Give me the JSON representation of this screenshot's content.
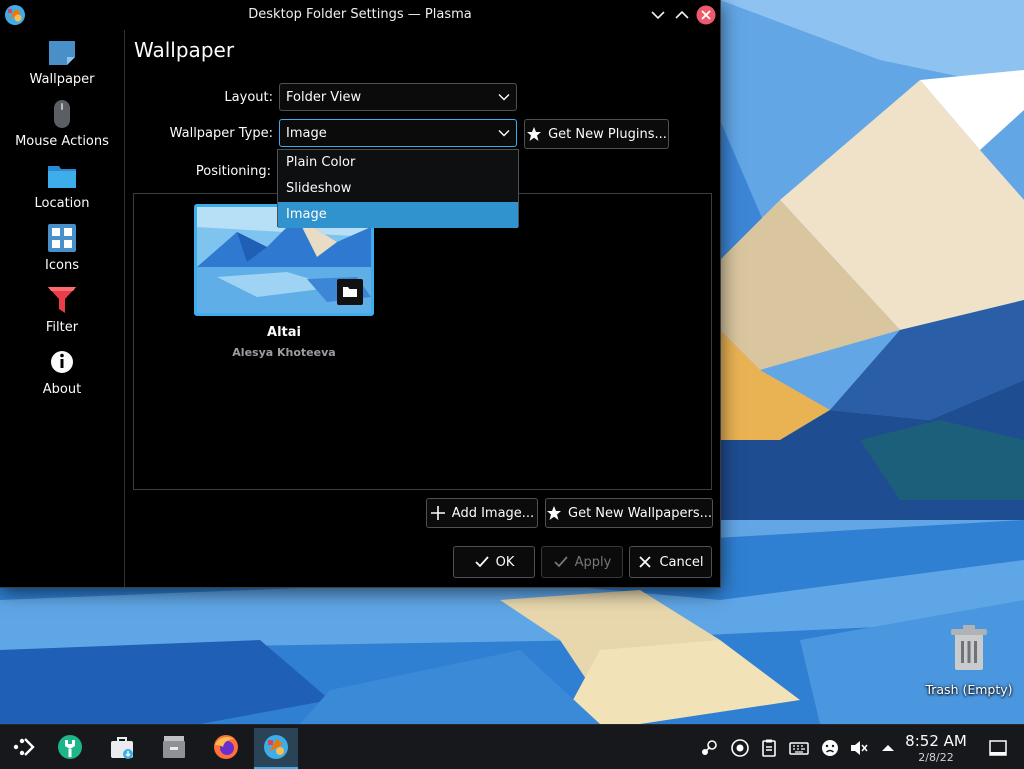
{
  "window": {
    "title": "Desktop Folder Settings — Plasma",
    "buttons": {
      "minimize": "chevron-down-icon",
      "maximize": "chevron-up-icon",
      "close": "close-icon"
    }
  },
  "sidebar": {
    "items": [
      {
        "label": "Wallpaper",
        "icon": "wallpaper-icon"
      },
      {
        "label": "Mouse Actions",
        "icon": "mouse-icon"
      },
      {
        "label": "Location",
        "icon": "folder-icon"
      },
      {
        "label": "Icons",
        "icon": "icons-grid-icon"
      },
      {
        "label": "Filter",
        "icon": "filter-icon"
      },
      {
        "label": "About",
        "icon": "info-icon"
      }
    ]
  },
  "page": {
    "title": "Wallpaper",
    "layout_label": "Layout:",
    "layout_value": "Folder View",
    "wallpaper_type_label": "Wallpaper Type:",
    "wallpaper_type_value": "Image",
    "get_new_plugins": "Get New Plugins...",
    "positioning_label": "Positioning:",
    "dropdown_options": [
      "Plain Color",
      "Slideshow",
      "Image"
    ],
    "dropdown_selected": "Image",
    "wallpaper_item": {
      "name": "Altai",
      "author": "Alesya Khoteeva"
    },
    "add_image": "Add Image...",
    "get_new_wallpapers": "Get New Wallpapers...",
    "ok": "OK",
    "apply": "Apply",
    "cancel": "Cancel"
  },
  "desktop": {
    "trash_label": "Trash (Empty)"
  },
  "taskbar": {
    "apps": [
      "application-launcher-icon",
      "discover-icon",
      "store-icon",
      "file-manager-icon",
      "firefox-icon",
      "system-settings-icon"
    ],
    "tray": [
      "steam-icon",
      "update-icon",
      "clipboard-icon",
      "keyboard-icon",
      "emoji-icon",
      "volume-muted-icon",
      "tray-expand-icon",
      "show-desktop-icon"
    ],
    "time": "8:52 AM",
    "date": "2/8/22"
  },
  "colors": {
    "accent": "#3daee9",
    "selection": "#3093ce",
    "window_bg": "#000000",
    "taskbar_bg": "#16181b"
  }
}
